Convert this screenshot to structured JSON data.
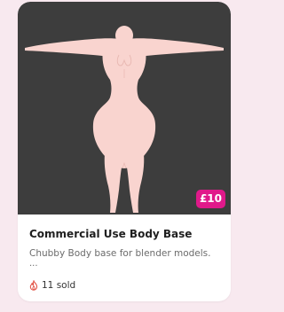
{
  "product": {
    "title": "Commercial Use Body Base",
    "description": "Chubby Body base for blender models.",
    "description_ellipsis": "...",
    "price": "£10",
    "sold": "11 sold"
  },
  "icons": {
    "sold": "flame-icon",
    "image": "body-base-thumbnail"
  },
  "colors": {
    "page_background": "#f8e9ef",
    "card_background": "#ffffff",
    "thumbnail_background": "#3d3d3d",
    "body_color": "#f9d4cf",
    "price_badge": "#e0198a",
    "sold_icon": "#e04a3c"
  }
}
